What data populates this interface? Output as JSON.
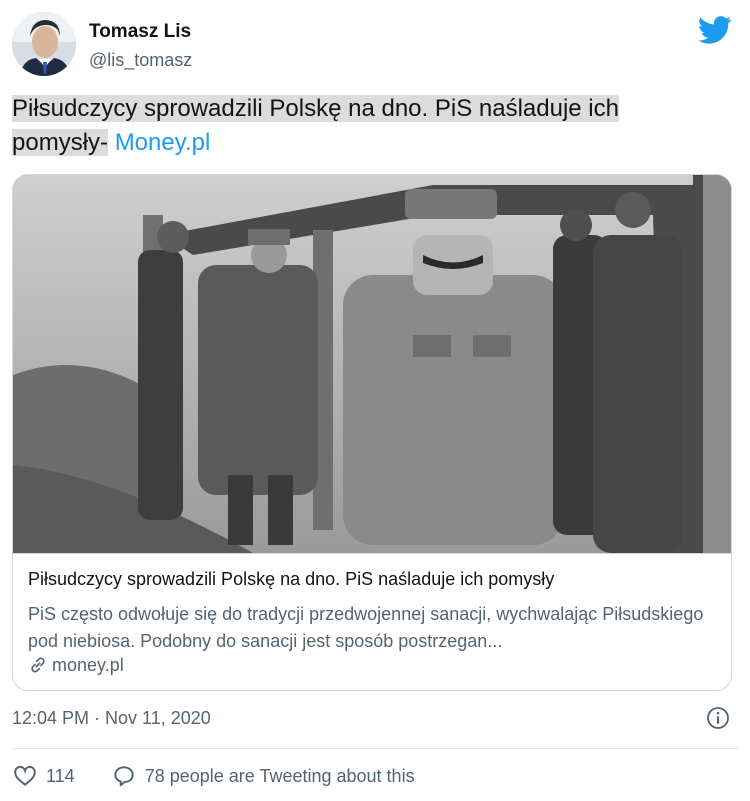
{
  "author": {
    "name": "Tomasz Lis",
    "handle": "@lis_tomasz"
  },
  "tweet": {
    "text_line1": "Piłsudczycy sprowadzili Polskę na dno. PiS naśladuje ich",
    "text_line2": "pomysły-",
    "link_text": "Money.pl"
  },
  "card": {
    "title": "Piłsudczycy sprowadzili Polskę na dno. PiS naśladuje ich pomysły",
    "description": "PiS często odwołuje się do tradycji przedwojennej sanacji, wychwalając Piłsudskiego pod niebiosa. Podobny do sanacji jest sposób postrzegan...",
    "domain": "money.pl"
  },
  "meta": {
    "timestamp": "12:04 PM · Nov 11, 2020"
  },
  "actions": {
    "like_count": "114",
    "reply_text": "78 people are Tweeting about this"
  },
  "icons": {
    "brand": "twitter-bird-icon",
    "info": "info-icon",
    "link": "link-icon",
    "like": "heart-icon",
    "reply": "reply-icon"
  },
  "colors": {
    "brand_blue": "#1d9bf0",
    "secondary_text": "#536471",
    "highlight": "#dcdcdc"
  }
}
